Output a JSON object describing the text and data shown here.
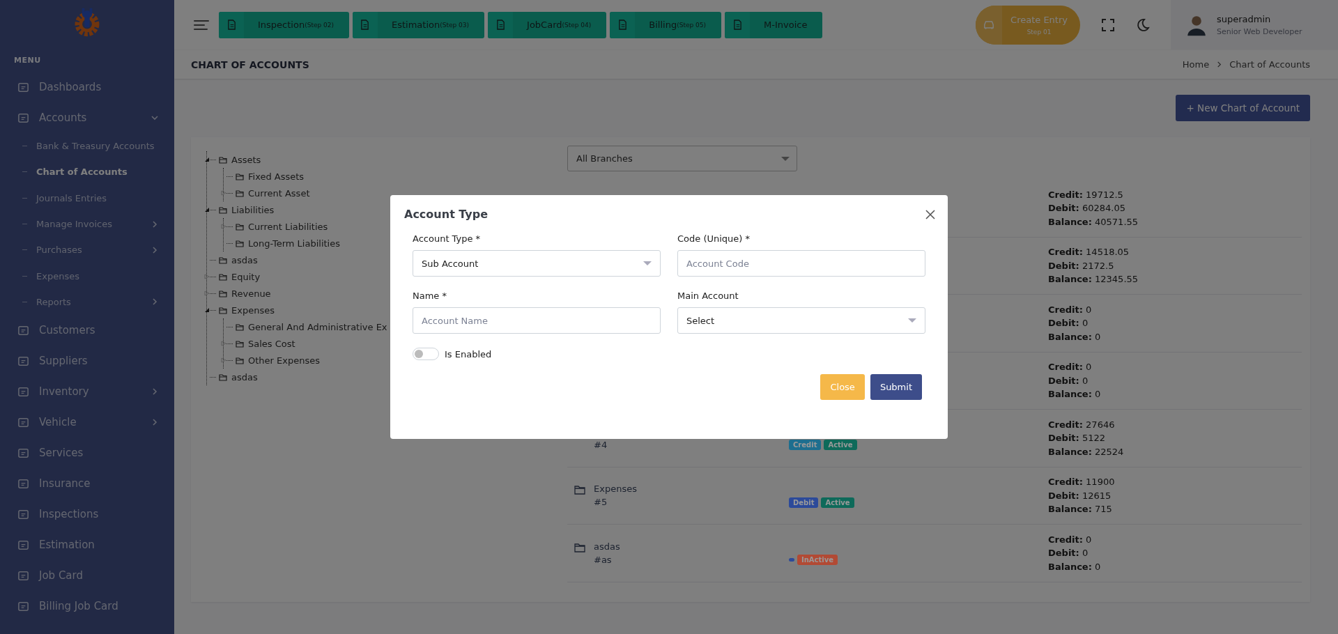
{
  "sidebar": {
    "menu_label": "MENU",
    "items": [
      {
        "label": "Dashboards",
        "selected": false
      },
      {
        "label": "Accounts",
        "selected": false,
        "expanded": true,
        "children": [
          {
            "label": "Bank & Treasury Accounts",
            "selected": false
          },
          {
            "label": "Chart of Accounts",
            "selected": true
          },
          {
            "label": "Journals Entries",
            "selected": false
          },
          {
            "label": "Manage Invoices",
            "selected": false,
            "expanded": false
          },
          {
            "label": "Purchases",
            "selected": false,
            "expanded": false
          },
          {
            "label": "Expenses",
            "selected": false
          },
          {
            "label": "Reports",
            "selected": false,
            "expanded": false
          }
        ]
      },
      {
        "label": "Customers",
        "selected": false
      },
      {
        "label": "Suppliers",
        "selected": false
      },
      {
        "label": "Inventory",
        "selected": false,
        "expanded": false
      },
      {
        "label": "Vehicle",
        "selected": false,
        "expanded": false
      },
      {
        "label": "Services",
        "selected": false
      },
      {
        "label": "Insurance",
        "selected": false
      },
      {
        "label": "Inspections",
        "selected": false
      },
      {
        "label": "Estimation",
        "selected": false
      },
      {
        "label": "Job Card",
        "selected": false
      },
      {
        "label": "Billing Job Card",
        "selected": false
      }
    ]
  },
  "topbar": {
    "steps": [
      {
        "label": "Inspection",
        "step": "(Step 02)"
      },
      {
        "label": "Estimation",
        "step": "(Step 03)"
      },
      {
        "label": "JobCard",
        "step": "(Step 04)"
      },
      {
        "label": "Billing",
        "step": "(Step 05)"
      },
      {
        "label": "M-Invoice"
      }
    ],
    "create_entry": {
      "label": "Create Entry",
      "step": "Step 01"
    },
    "user": {
      "name": "superadmin",
      "role": "Senior Web Developer"
    }
  },
  "page_header": {
    "title": "CHART OF ACCOUNTS",
    "breadcrumb": [
      "Home",
      "Chart of Accounts"
    ]
  },
  "new_button": "+ New Chart of Account",
  "tree": [
    {
      "label": "Assets",
      "kind": "expanded",
      "children": [
        {
          "label": "Fixed Assets",
          "kind": "leaf"
        },
        {
          "label": "Current Asset",
          "kind": "collapsed"
        }
      ]
    },
    {
      "label": "Liabilities",
      "kind": "expanded",
      "children": [
        {
          "label": "Current Liabilities",
          "kind": "collapsed"
        },
        {
          "label": "Long-Term Liabilities",
          "kind": "leaf"
        }
      ]
    },
    {
      "label": "asdas",
      "kind": "leaf"
    },
    {
      "label": "Equity",
      "kind": "collapsed"
    },
    {
      "label": "Revenue",
      "kind": "collapsed"
    },
    {
      "label": "Expenses",
      "kind": "expanded",
      "children": [
        {
          "label": "General And Administrative Ex",
          "kind": "leaf"
        },
        {
          "label": "Sales Cost",
          "kind": "collapsed"
        },
        {
          "label": "Other Expenses",
          "kind": "collapsed"
        }
      ]
    },
    {
      "label": "asdas",
      "kind": "leaf"
    }
  ],
  "branch_filter": "All Branches",
  "accounts": [
    {
      "totals": [
        "**Credit:** 19712.5",
        "**Debit:** 60284.05",
        "**Balance:** 40571.55"
      ]
    },
    {
      "totals": [
        "**Credit:** 14518.05",
        "**Debit:** 2172.5",
        "**Balance:** 12345.55"
      ]
    },
    {
      "totals": [
        "**Credit:** 0",
        "**Debit:** 0",
        "**Balance:** 0"
      ]
    },
    {
      "totals": [
        "**Credit:** 0",
        "**Debit:** 0",
        "**Balance:** 0"
      ]
    },
    {
      "code": "#4",
      "badges": [
        {
          "text": "Credit",
          "color": "#1d6e8f"
        },
        {
          "text": "Active",
          "color": "#0e6a5a"
        }
      ],
      "totals": [
        "**Credit:** 27646",
        "**Debit:** 5122",
        "**Balance:** 22524"
      ]
    },
    {
      "name": "Expenses",
      "code": "#5",
      "badges": [
        {
          "text": "Debit",
          "color": "#2c4a9a"
        },
        {
          "text": "Active",
          "color": "#0e6a5a"
        }
      ],
      "totals": [
        "**Credit:** 11900",
        "**Debit:** 12615",
        "**Balance:** 715"
      ]
    },
    {
      "name": "asdas",
      "code": "#as",
      "badges": [
        {
          "color": "#2c4a9a"
        },
        {
          "text": "InActive",
          "color": "#b24a34"
        }
      ],
      "totals": [
        "**Credit:** 0",
        "**Debit:** 0",
        "**Balance:** 0"
      ]
    }
  ],
  "modal": {
    "title": "Account Type",
    "fields": [
      {
        "label": "Account Type *",
        "kind": "select",
        "value": "Sub Account"
      },
      {
        "label": "Code (Unique) *",
        "kind": "input",
        "placeholder": "Account Code"
      },
      {
        "label": "Name *",
        "kind": "input",
        "placeholder": "Account Name"
      },
      {
        "label": "Main Account",
        "kind": "select",
        "value": "Select"
      }
    ],
    "toggle": {
      "label": "Is Enabled",
      "on": false
    },
    "buttons": [
      {
        "label": "Close",
        "kind": "secondary"
      },
      {
        "label": "Submit",
        "kind": "primary"
      }
    ]
  }
}
